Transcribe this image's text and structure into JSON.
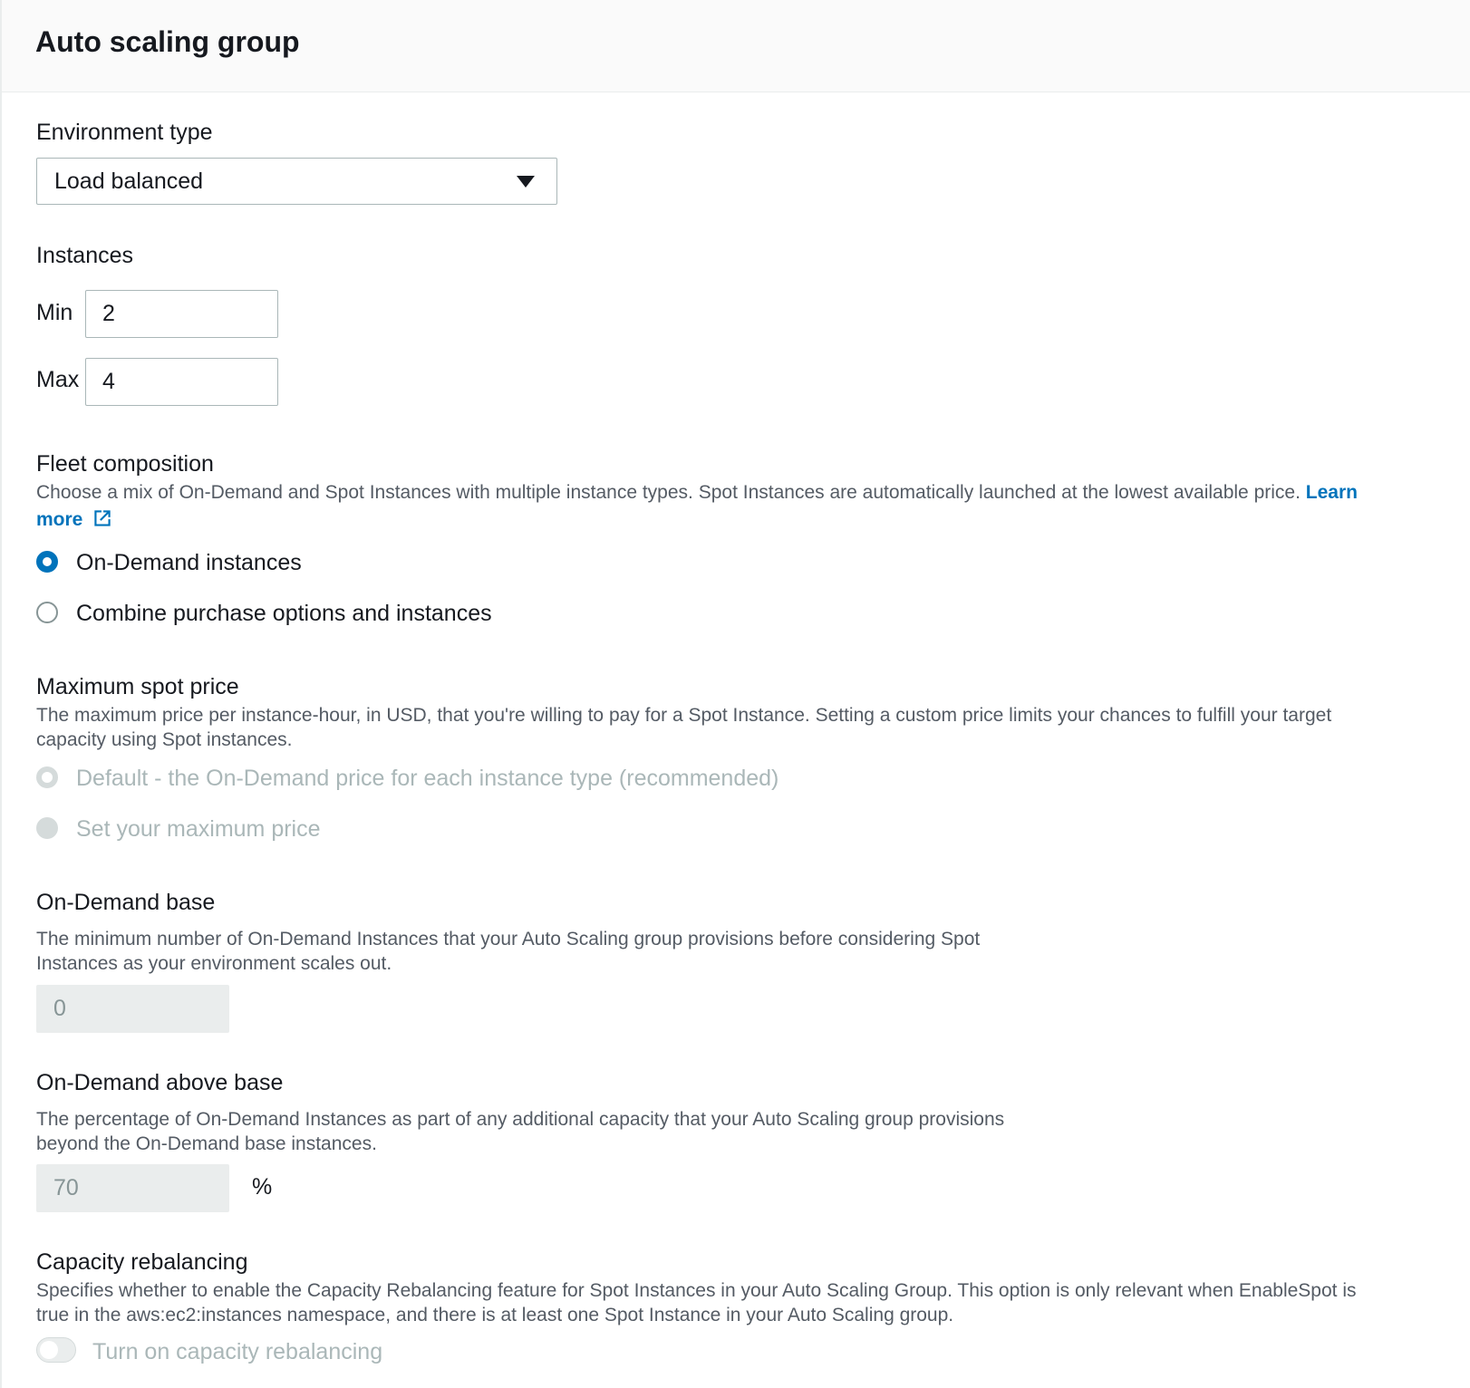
{
  "header": {
    "title": "Auto scaling group"
  },
  "environment": {
    "label": "Environment type",
    "selected": "Load balanced"
  },
  "instances": {
    "label": "Instances",
    "min_label": "Min",
    "min_value": "2",
    "max_label": "Max",
    "max_value": "4"
  },
  "fleet": {
    "label": "Fleet composition",
    "description": "Choose a mix of On-Demand and Spot Instances with multiple instance types. Spot Instances are automatically launched at the lowest available price.",
    "link_part1": "Learn",
    "link_part2": "more",
    "option1": "On-Demand instances",
    "option2": "Combine purchase options and instances"
  },
  "spot": {
    "label": "Maximum spot price",
    "description_line1": "The maximum price per instance-hour, in USD, that you're willing to pay for a Spot Instance. Setting a custom price limits your chances to fulfill your target",
    "description_line2": "capacity using Spot instances.",
    "option1": "Default - the On-Demand price for each instance type (recommended)",
    "option2": "Set your maximum price"
  },
  "base": {
    "label": "On-Demand base",
    "description_line1": "The minimum number of On-Demand Instances that your Auto Scaling group provisions before considering Spot",
    "description_line2": "Instances as your environment scales out.",
    "value": "0"
  },
  "above_base": {
    "label": "On-Demand above base",
    "description_line1": "The percentage of On-Demand Instances as part of any additional capacity that your Auto Scaling group provisions",
    "description_line2": "beyond the On-Demand base instances.",
    "value": "70",
    "unit": "%"
  },
  "rebalancing": {
    "label": "Capacity rebalancing",
    "description_line1": "Specifies whether to enable the Capacity Rebalancing feature for Spot Instances in your Auto Scaling Group. This option is only relevant when EnableSpot is",
    "description_line2": "true in the aws:ec2:instances namespace, and there is at least one Spot Instance in your Auto Scaling group.",
    "toggle_label": "Turn on capacity rebalancing"
  },
  "colors": {
    "accent": "#0073bb",
    "disabled": "#aab7b8",
    "muted": "#545b64"
  },
  "icons": {
    "dropdown": "caret-down-icon",
    "external": "external-link-icon"
  }
}
